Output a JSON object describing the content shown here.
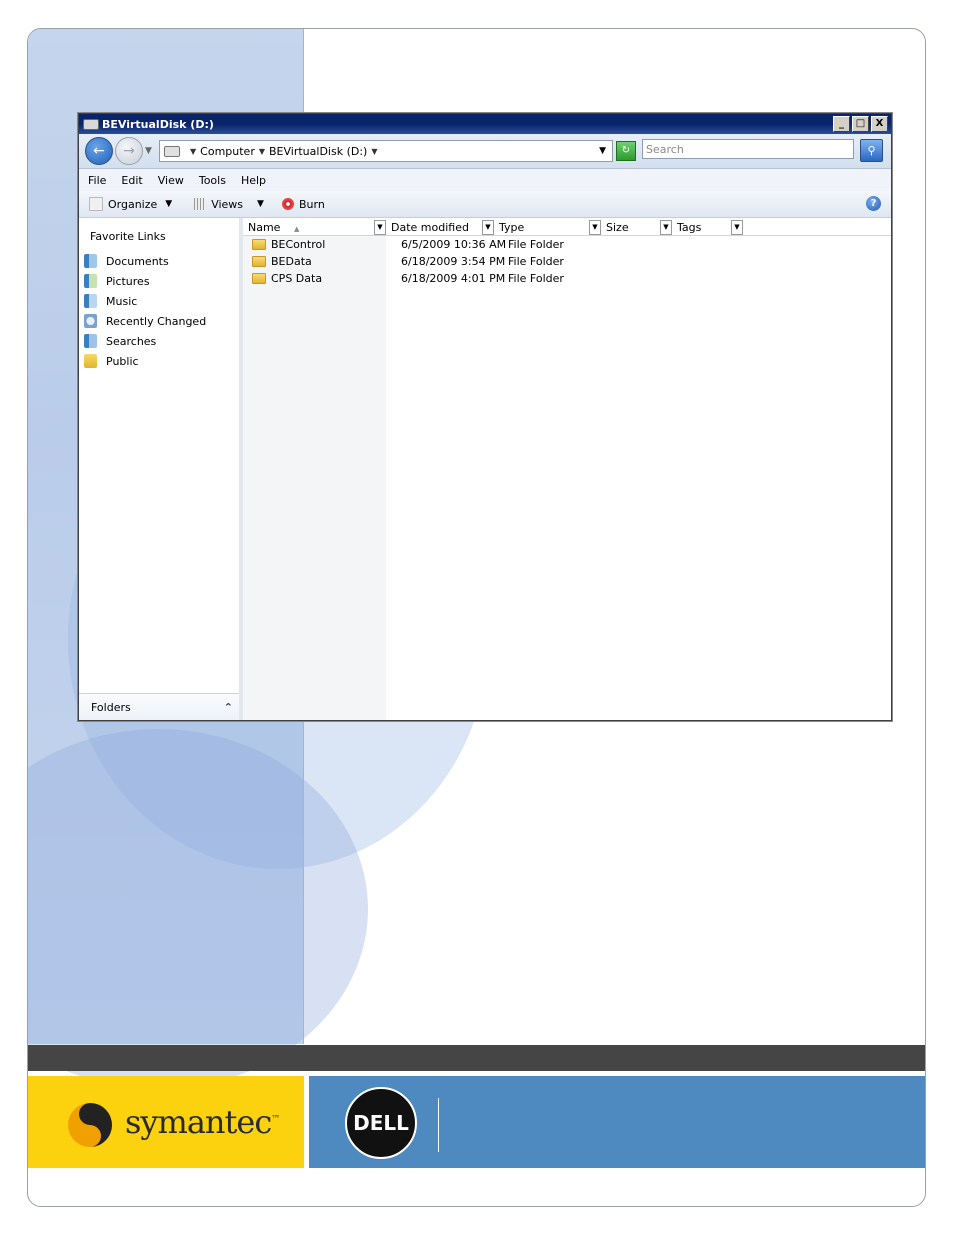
{
  "window": {
    "title": "BEVirtualDisk (D:)",
    "controls": [
      "_",
      "□",
      "X"
    ]
  },
  "navbar": {
    "breadcrumb": [
      "Computer",
      "BEVirtualDisk (D:)"
    ],
    "search_placeholder": "Search"
  },
  "menu": [
    "File",
    "Edit",
    "View",
    "Tools",
    "Help"
  ],
  "toolbar": {
    "organize": "Organize",
    "views": "Views",
    "burn": "Burn"
  },
  "nav_pane": {
    "title": "Favorite Links",
    "links": [
      {
        "label": "Documents",
        "icon": "documents-icon"
      },
      {
        "label": "Pictures",
        "icon": "pictures-icon"
      },
      {
        "label": "Music",
        "icon": "music-icon"
      },
      {
        "label": "Recently Changed",
        "icon": "recently-changed-icon"
      },
      {
        "label": "Searches",
        "icon": "searches-icon"
      },
      {
        "label": "Public",
        "icon": "public-folder-icon"
      }
    ],
    "folders_label": "Folders"
  },
  "columns": [
    "Name",
    "Date modified",
    "Type",
    "Size",
    "Tags"
  ],
  "files": [
    {
      "name": "BEControl",
      "date": "6/5/2009 10:36 AM",
      "type": "File Folder"
    },
    {
      "name": "BEData",
      "date": "6/18/2009 3:54 PM",
      "type": "File Folder"
    },
    {
      "name": "CPS Data",
      "date": "6/18/2009 4:01 PM",
      "type": "File Folder"
    }
  ],
  "footer": {
    "symantec": "symantec",
    "dell": "DELL"
  }
}
